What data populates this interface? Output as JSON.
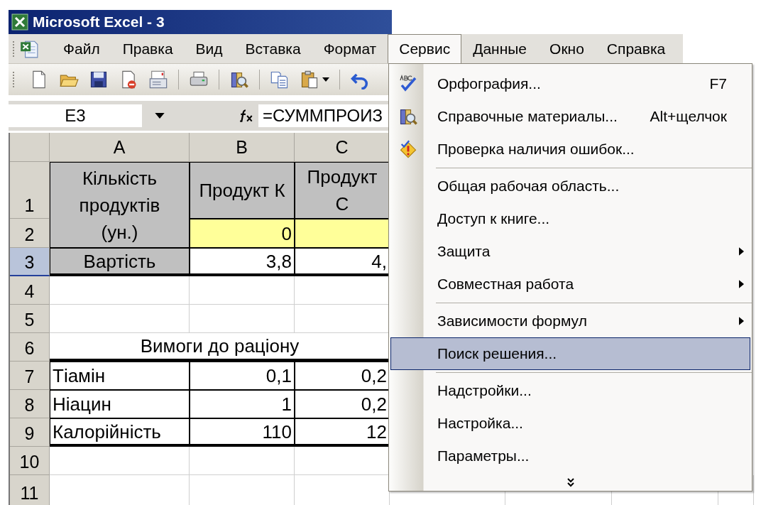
{
  "window": {
    "title": "Microsoft Excel - 3"
  },
  "menu_bar": [
    {
      "label": "Файл",
      "selected": false
    },
    {
      "label": "Правка",
      "selected": false
    },
    {
      "label": "Вид",
      "selected": false
    },
    {
      "label": "Вставка",
      "selected": false
    },
    {
      "label": "Формат",
      "selected": false
    },
    {
      "label": "Сервис",
      "selected": true
    },
    {
      "label": "Данные",
      "selected": false
    },
    {
      "label": "Окно",
      "selected": false
    },
    {
      "label": "Справка",
      "selected": false
    }
  ],
  "formula_bar": {
    "name_box": "E3",
    "formula": "=СУММПРОИЗ"
  },
  "sheet": {
    "columns": [
      {
        "label": "A"
      },
      {
        "label": "B"
      },
      {
        "label": "C"
      }
    ],
    "rows": [
      {
        "header": "1",
        "selected": false,
        "kind": "block",
        "cells": [
          {
            "kind": "label-tall",
            "text": "Кількість продуктів (ун.)",
            "color": "#c0c0c0"
          },
          {
            "kind": "label",
            "text": "Продукт К",
            "color": "#c0c0c0"
          },
          {
            "kind": "label",
            "text": "Продукт\nС",
            "color": "#c0c0c0"
          }
        ]
      },
      {
        "header": "2",
        "selected": false,
        "kind": "block",
        "cells": [
          {
            "kind": "number",
            "text": "0",
            "color": "#ffff99"
          },
          {
            "kind": "number",
            "color": "#ffff99"
          }
        ]
      },
      {
        "header": "3",
        "selected": true,
        "kind": "block-end",
        "cells": [
          {
            "kind": "label",
            "text": "Вартість",
            "color": "#c0c0c0"
          },
          {
            "kind": "number",
            "text": "3,8"
          },
          {
            "kind": "number",
            "text": "4,"
          }
        ]
      },
      {
        "header": "4",
        "selected": false,
        "cells": []
      },
      {
        "header": "5",
        "selected": false,
        "cells": []
      },
      {
        "header": "6",
        "selected": false,
        "kind": "caption",
        "cells": [
          {
            "kind": "caption",
            "text": "Вимоги до раціону"
          }
        ]
      },
      {
        "header": "7",
        "selected": false,
        "kind": "table",
        "cells": [
          {
            "kind": "text",
            "text": "Тіамін"
          },
          {
            "kind": "number",
            "text": "0,1"
          },
          {
            "kind": "number",
            "text": "0,2"
          }
        ]
      },
      {
        "header": "8",
        "selected": false,
        "kind": "table",
        "cells": [
          {
            "kind": "text",
            "text": "Ніацин"
          },
          {
            "kind": "number",
            "text": "1"
          },
          {
            "kind": "number",
            "text": "0,2"
          }
        ]
      },
      {
        "header": "9",
        "selected": false,
        "kind": "table-end",
        "cells": [
          {
            "kind": "text",
            "text": "Калорійність"
          },
          {
            "kind": "number",
            "text": "110"
          },
          {
            "kind": "number",
            "text": "12"
          }
        ]
      },
      {
        "header": "10",
        "selected": false,
        "cells": []
      },
      {
        "header": "11",
        "selected": false,
        "cells": []
      }
    ]
  },
  "dropdown_menu": [
    {
      "kind": "item",
      "label": "Орфография...",
      "shortcut": "F7",
      "has_submenu": false,
      "selected": false
    },
    {
      "kind": "item",
      "label": "Справочные материалы...",
      "shortcut": "Alt+щелчок",
      "has_submenu": false,
      "selected": false
    },
    {
      "kind": "item",
      "label": "Проверка наличия ошибок...",
      "has_submenu": false,
      "selected": false
    },
    {
      "kind": "separator"
    },
    {
      "kind": "item",
      "label": "Общая рабочая область...",
      "has_submenu": false,
      "selected": false
    },
    {
      "kind": "item",
      "label": "Доступ к книге...",
      "has_submenu": false,
      "selected": false
    },
    {
      "kind": "item",
      "label": "Защита",
      "has_submenu": true,
      "selected": false
    },
    {
      "kind": "item",
      "label": "Совместная работа",
      "has_submenu": true,
      "selected": false
    },
    {
      "kind": "separator"
    },
    {
      "kind": "item",
      "label": "Зависимости формул",
      "has_submenu": true,
      "selected": false
    },
    {
      "kind": "item",
      "label": "Поиск решения...",
      "has_submenu": false,
      "selected": true
    },
    {
      "kind": "separator"
    },
    {
      "kind": "item",
      "label": "Надстройки...",
      "has_submenu": false,
      "selected": false
    },
    {
      "kind": "item",
      "label": "Настройка...",
      "has_submenu": false,
      "selected": false
    },
    {
      "kind": "item",
      "label": "Параметры...",
      "has_submenu": false,
      "selected": false
    },
    {
      "kind": "expander"
    }
  ]
}
